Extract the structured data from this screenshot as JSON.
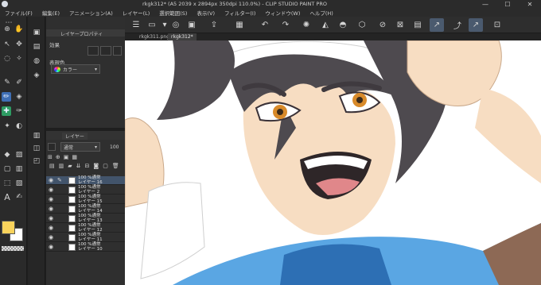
{
  "window": {
    "title": "rkgk312* (A5 2039 x 2894px 350dpi 110.0%) - CLIP STUDIO PAINT PRO",
    "minimize": "—",
    "maximize": "☐",
    "close": "✕"
  },
  "menu": {
    "items": [
      {
        "label": "ファイル(F)"
      },
      {
        "label": "編集(E)"
      },
      {
        "label": "アニメーション(A)"
      },
      {
        "label": "レイヤー(L)"
      },
      {
        "label": "選択範囲(S)"
      },
      {
        "label": "表示(V)"
      },
      {
        "label": "フィルター(I)"
      },
      {
        "label": "ウィンドウ(W)"
      },
      {
        "label": "ヘルプ(H)"
      }
    ]
  },
  "property_panel": {
    "tab_label": "レイヤープロパティ",
    "effect_label": "効果",
    "expression_color_label": "表現色",
    "expression_color_value": "カラー"
  },
  "layer_panel": {
    "tab_label": "レイヤー",
    "blend_mode": "通常",
    "opacity": "100",
    "layers": [
      {
        "line1": "100 %通常",
        "line2": "レイヤー 16",
        "selected": true
      },
      {
        "line1": "100 %通常",
        "line2": "レイヤー 2",
        "selected": false
      },
      {
        "line1": "100 %通常",
        "line2": "レイヤー 15",
        "selected": false
      },
      {
        "line1": "100 %通常",
        "line2": "レイヤー 14",
        "selected": false
      },
      {
        "line1": "100 %通常",
        "line2": "レイヤー 13",
        "selected": false
      },
      {
        "line1": "100 %通常",
        "line2": "レイヤー 12",
        "selected": false
      },
      {
        "line1": "100 %通常",
        "line2": "レイヤー 11",
        "selected": false
      },
      {
        "line1": "100 %通常",
        "line2": "レイヤー 10",
        "selected": false
      }
    ]
  },
  "document_tabs": [
    {
      "label": "rkgk311.png",
      "active": false
    },
    {
      "label": "rkgk312*",
      "active": true
    }
  ],
  "colors": {
    "main_color": "#f9d35c",
    "sub_color": "#ffffff",
    "selection_accent": "#42546b",
    "active_tool": "#3f6fb5"
  }
}
